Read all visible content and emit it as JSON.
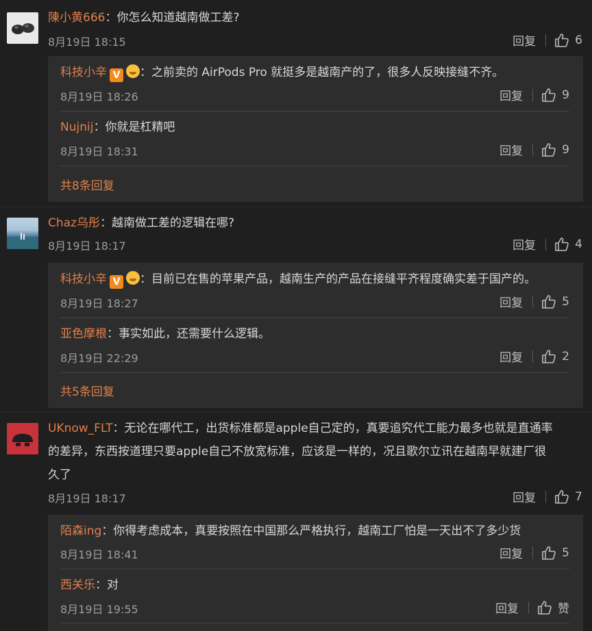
{
  "threads": [
    {
      "username": "陳小黄666",
      "text": "你怎么知道越南做工差?",
      "time": "8月19日 18:15",
      "reply_label": "回复",
      "likes": "6",
      "replies": [
        {
          "username": "科技小辛",
          "text": "之前卖的 AirPods Pro 就挺多是越南产的了，很多人反映接缝不齐。",
          "time": "8月19日 18:26",
          "reply_label": "回复",
          "likes": "9",
          "verified": true
        },
        {
          "username": "Nujnij",
          "text": "你就是杠精吧",
          "time": "8月19日 18:31",
          "reply_label": "回复",
          "likes": "9"
        }
      ],
      "more": "共8条回复"
    },
    {
      "username": "Chaz乌彤",
      "text": "越南做工差的逻辑在哪?",
      "time": "8月19日 18:17",
      "reply_label": "回复",
      "likes": "4",
      "replies": [
        {
          "username": "科技小辛",
          "text": "目前已在售的苹果产品，越南生产的产品在接缝平齐程度确实差于国产的。",
          "time": "8月19日 18:27",
          "reply_label": "回复",
          "likes": "5",
          "verified": true
        },
        {
          "username": "亚色摩根",
          "text": "事实如此，还需要什么逻辑。",
          "time": "8月19日 22:29",
          "reply_label": "回复",
          "likes": "2"
        }
      ],
      "more": "共5条回复"
    },
    {
      "username": "UKnow_FLT",
      "text_line1": "无论在哪代工，出货标准都是apple自己定的，真要追究代工能力最多也就是直通率",
      "text_line2": "的差异，东西按道理只要apple自己不放宽标准，应该是一样的，况且歌尔立讯在越南早就建厂很",
      "text_line3": "久了",
      "time": "8月19日 18:17",
      "reply_label": "回复",
      "likes": "7",
      "replies": [
        {
          "username": "陌森ing",
          "text": "你得考虑成本，真要按照在中国那么严格执行，越南工厂怕是一天出不了多少货",
          "time": "8月19日 18:41",
          "reply_label": "回复",
          "likes": "5"
        },
        {
          "username": "西关乐",
          "text": "对",
          "time": "8月19日 19:55",
          "reply_label": "回复",
          "likes": "赞"
        }
      ]
    }
  ],
  "colon": "：",
  "colors": {
    "background": "#1f1f1f",
    "reply_box": "#2d2d2d",
    "username": "#e0804c",
    "text": "#d8d8d8",
    "meta": "#9d9d9d"
  },
  "icons": {
    "like": "thumbs-up-icon",
    "verified": "v-badge-icon",
    "emoji": "smiley-badge-icon"
  }
}
